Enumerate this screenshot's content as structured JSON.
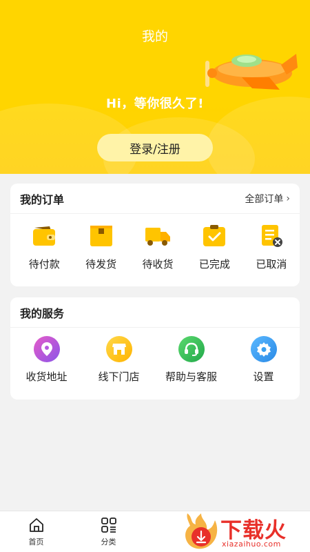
{
  "header": {
    "title": "我的",
    "greeting": "Hi，等你很久了!",
    "login_label": "登录/注册"
  },
  "orders": {
    "title": "我的订单",
    "all_label": "全部订单",
    "items": [
      {
        "label": "待付款",
        "icon": "wallet-icon"
      },
      {
        "label": "待发货",
        "icon": "package-icon"
      },
      {
        "label": "待收货",
        "icon": "truck-icon"
      },
      {
        "label": "已完成",
        "icon": "clipboard-check-icon"
      },
      {
        "label": "已取消",
        "icon": "document-cancel-icon"
      }
    ]
  },
  "services": {
    "title": "我的服务",
    "items": [
      {
        "label": "收货地址",
        "icon": "location-pin-icon",
        "color": "#b55be0"
      },
      {
        "label": "线下门店",
        "icon": "store-icon",
        "color": "#ffc20e"
      },
      {
        "label": "帮助与客服",
        "icon": "headset-icon",
        "color": "#3cc35b"
      },
      {
        "label": "设置",
        "icon": "gear-icon",
        "color": "#3aa0f0"
      }
    ]
  },
  "tabbar": {
    "items": [
      {
        "label": "首页",
        "icon": "home-icon"
      },
      {
        "label": "分类",
        "icon": "category-icon"
      }
    ]
  },
  "watermark": {
    "text": "下载火",
    "sub": "xiazaihuo.com"
  },
  "colors": {
    "brand_yellow": "#ffd500",
    "order_icon_yellow": "#ffc400",
    "watermark_red": "#e8302a"
  }
}
